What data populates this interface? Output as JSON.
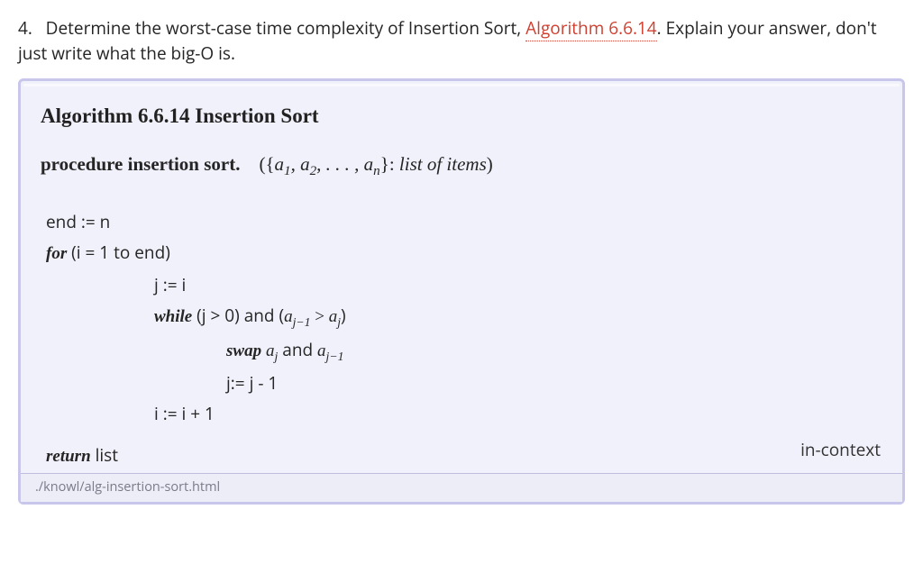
{
  "question": {
    "number": "4.",
    "part1": "Determine the worst-case time complexity of Insertion Sort, ",
    "link": "Algorithm 6.6.14",
    "part2": ". Explain your answer, don't just write what the big-O is."
  },
  "algorithm": {
    "title": "Algorithm 6.6.14  Insertion Sort",
    "procedure_label": "procedure insertion sort.",
    "signature_open": "({",
    "sig_items": "a",
    "sig_sub1": "1",
    "sig_comma": ", a",
    "sig_sub2": "2",
    "sig_dots": ", . . . , a",
    "sig_subn": "n",
    "signature_close": "}: ",
    "signature_desc": "list of items",
    "signature_paren": ")",
    "lines": {
      "l1": "end := n",
      "for_kw": "for",
      "l2_rest": " (i = 1 to end)",
      "l3": "j := i",
      "while_kw": "while",
      "l4_a": " (j > 0) and (",
      "l4_b": " > ",
      "l4_c": ")",
      "swap_kw": "swap",
      "l5_a": " ",
      "l5_b": " and ",
      "l6": "j:= j - 1",
      "l7": "i := i + 1",
      "return_kw": "return",
      "l8_rest": " list"
    },
    "context_link": "in-context",
    "footer_path": "./knowl/alg-insertion-sort.html"
  }
}
